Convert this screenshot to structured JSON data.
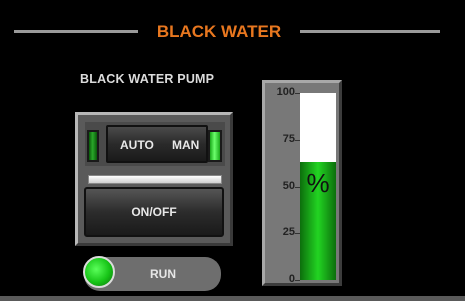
{
  "header": {
    "title": "BLACK WATER"
  },
  "pump": {
    "label": "BLACK WATER PUMP",
    "auto_label": "AUTO",
    "man_label": "MAN",
    "onoff_label": "ON/OFF",
    "run_label": "RUN"
  },
  "tank": {
    "unit_label": "%",
    "ticks": [
      "100",
      "75",
      "50",
      "25",
      "0"
    ],
    "level_percent": 63
  },
  "colors": {
    "title": "#e8771f",
    "led_on": "#3fd83f",
    "fill": "#22d422"
  }
}
